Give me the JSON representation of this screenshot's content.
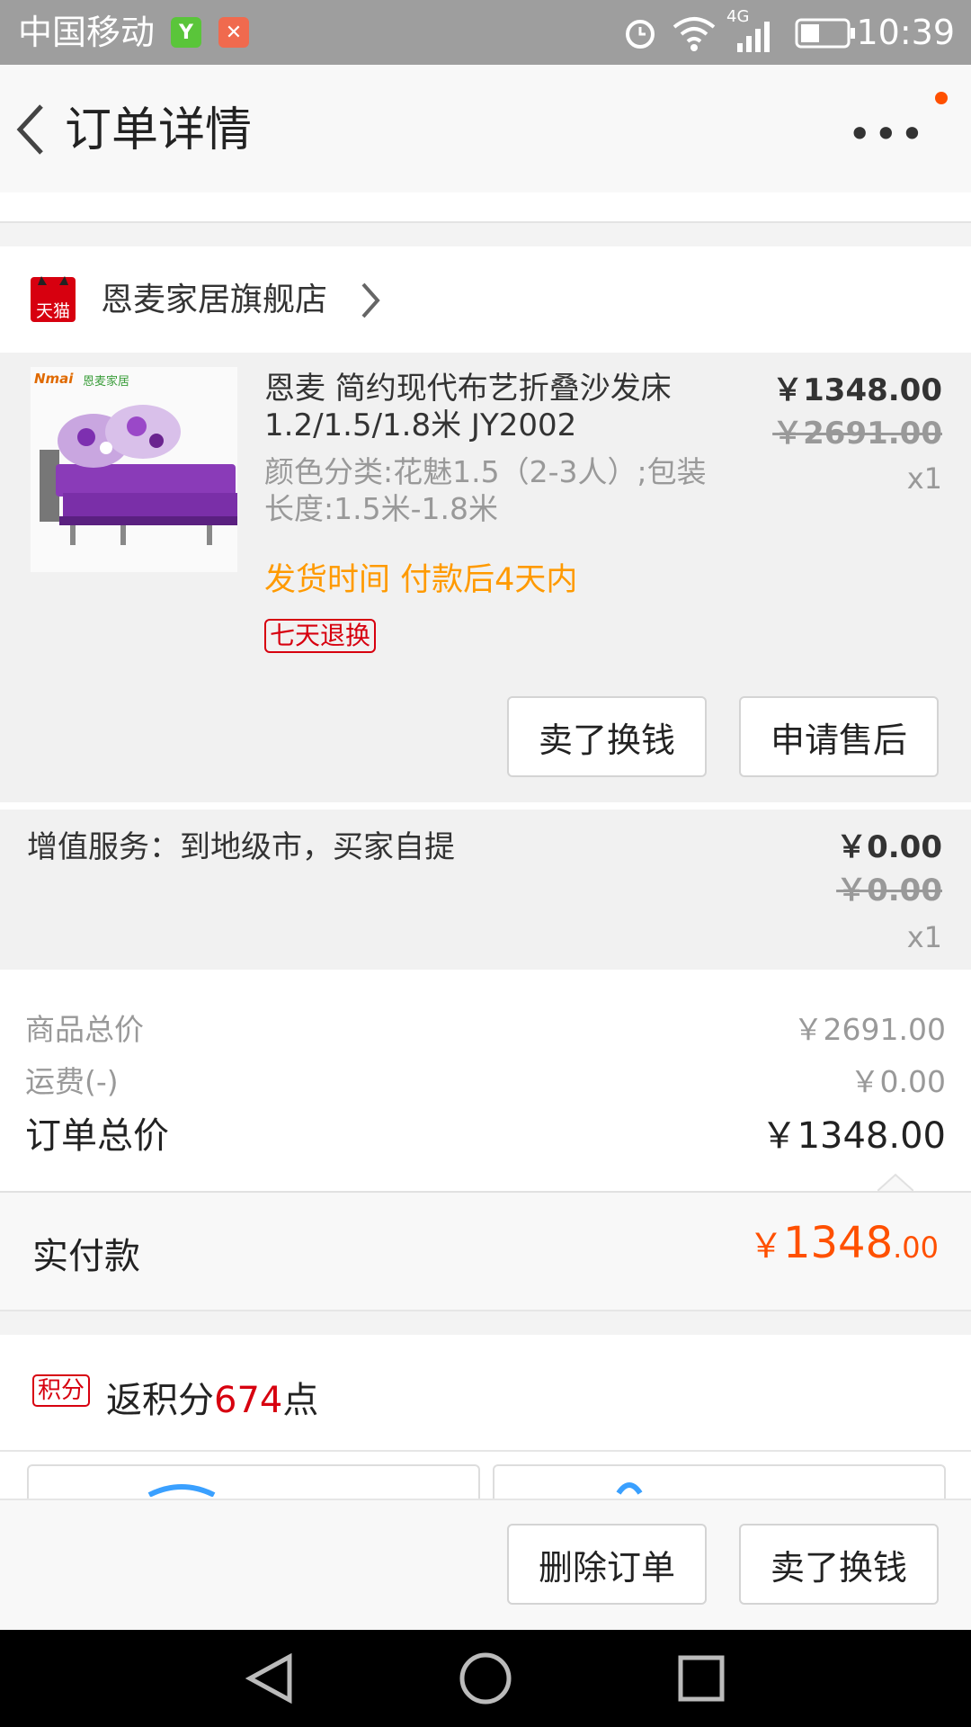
{
  "status_bar": {
    "carrier": "中国移动",
    "network": "4G",
    "time": "10:39"
  },
  "header": {
    "title": "订单详情"
  },
  "store": {
    "badge": "天猫",
    "name": "恩麦家居旗舰店"
  },
  "product": {
    "title": "恩麦 简约现代布艺折叠沙发床1.2/1.5/1.8米 JY2002",
    "sku": "颜色分类:花魅1.5（2-3人）;包装长度:1.5米-1.8米",
    "price": "￥1348.00",
    "original_price": "￥2691.00",
    "quantity": "x1",
    "shipping": "发货时间 付款后4天内",
    "tag": "七天退换",
    "thumb_brand": "Nmai",
    "thumb_brand_cn": "恩麦家居",
    "actions": [
      "卖了换钱",
      "申请售后"
    ]
  },
  "service": {
    "label": "增值服务：到地级市，买家自提",
    "price": "￥0.00",
    "original_price": "￥0.00",
    "quantity": "x1"
  },
  "totals": {
    "goods_label": "商品总价",
    "goods_value": "￥2691.00",
    "freight_label": "运费(-)",
    "freight_value": "￥0.00",
    "order_label": "订单总价",
    "order_value": "￥1348.00"
  },
  "payment": {
    "label": "实付款",
    "currency": "￥",
    "integer": "1348",
    "decimal": ".00"
  },
  "points": {
    "badge": "积分",
    "text_before": "返积分",
    "value": "674",
    "text_after": "点"
  },
  "bottom_actions": [
    "删除订单",
    "卖了换钱"
  ],
  "colors": {
    "accent": "#ff5000",
    "tmall_red": "#d7000f",
    "shipping_orange": "#ff9a00"
  }
}
